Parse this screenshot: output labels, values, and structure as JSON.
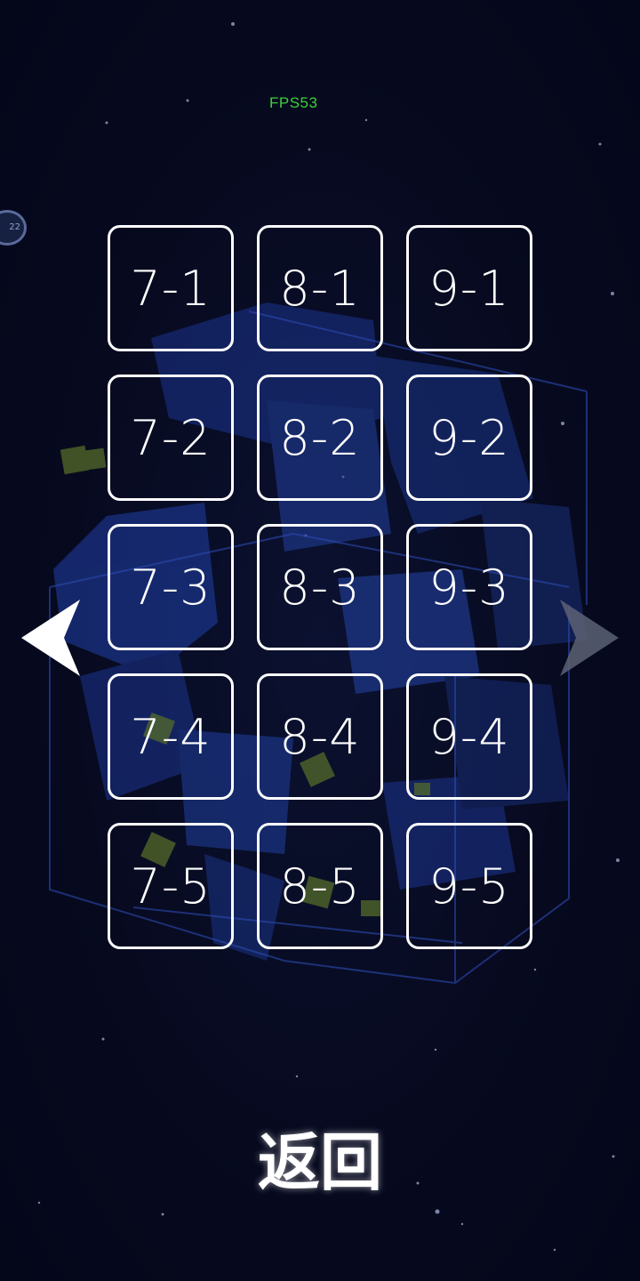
{
  "hud": {
    "fps": "FPS53",
    "side_badge": "22"
  },
  "levels": [
    [
      "7-1",
      "8-1",
      "9-1"
    ],
    [
      "7-2",
      "8-2",
      "9-2"
    ],
    [
      "7-3",
      "8-3",
      "9-3"
    ],
    [
      "7-4",
      "8-4",
      "9-4"
    ],
    [
      "7-5",
      "8-5",
      "9-5"
    ]
  ],
  "navigation": {
    "prev_icon": "left-arrow-icon",
    "next_icon": "right-arrow-icon",
    "back_label": "返回"
  },
  "colors": {
    "background": "#06091c",
    "fps_text": "#3ad13a",
    "cube_blue": "#1e3a9a",
    "button_border": "#ffffff"
  }
}
